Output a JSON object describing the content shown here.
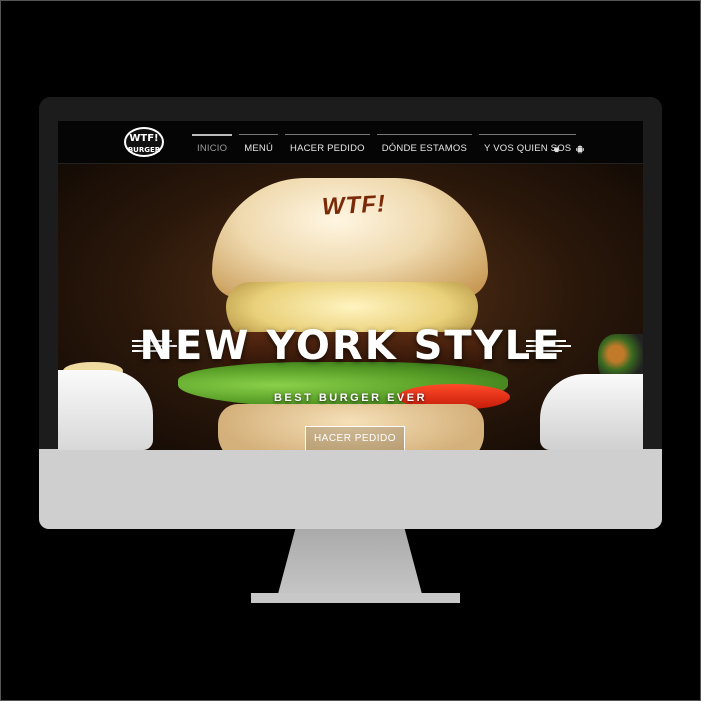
{
  "nav": {
    "logo_text": "WTF! BURGER",
    "items": [
      {
        "label": "INICIO",
        "active": true
      },
      {
        "label": "MENÚ",
        "active": false
      },
      {
        "label": "HACER PEDIDO",
        "active": false
      },
      {
        "label": "DÓNDE ESTAMOS",
        "active": false
      },
      {
        "label": "Y VOS QUIEN SOS",
        "active": false
      }
    ],
    "store_icons": [
      "apple-icon",
      "android-icon"
    ]
  },
  "hero": {
    "bun_brand": "WTF!",
    "headline": "NEW YORK STYLE",
    "subline": "BEST BURGER EVER",
    "cta_label": "HACER PEDIDO"
  },
  "colors": {
    "background": "#000000",
    "navbar": "#050505",
    "monitor_chin": "#cfcfcf",
    "text": "#ffffff"
  }
}
